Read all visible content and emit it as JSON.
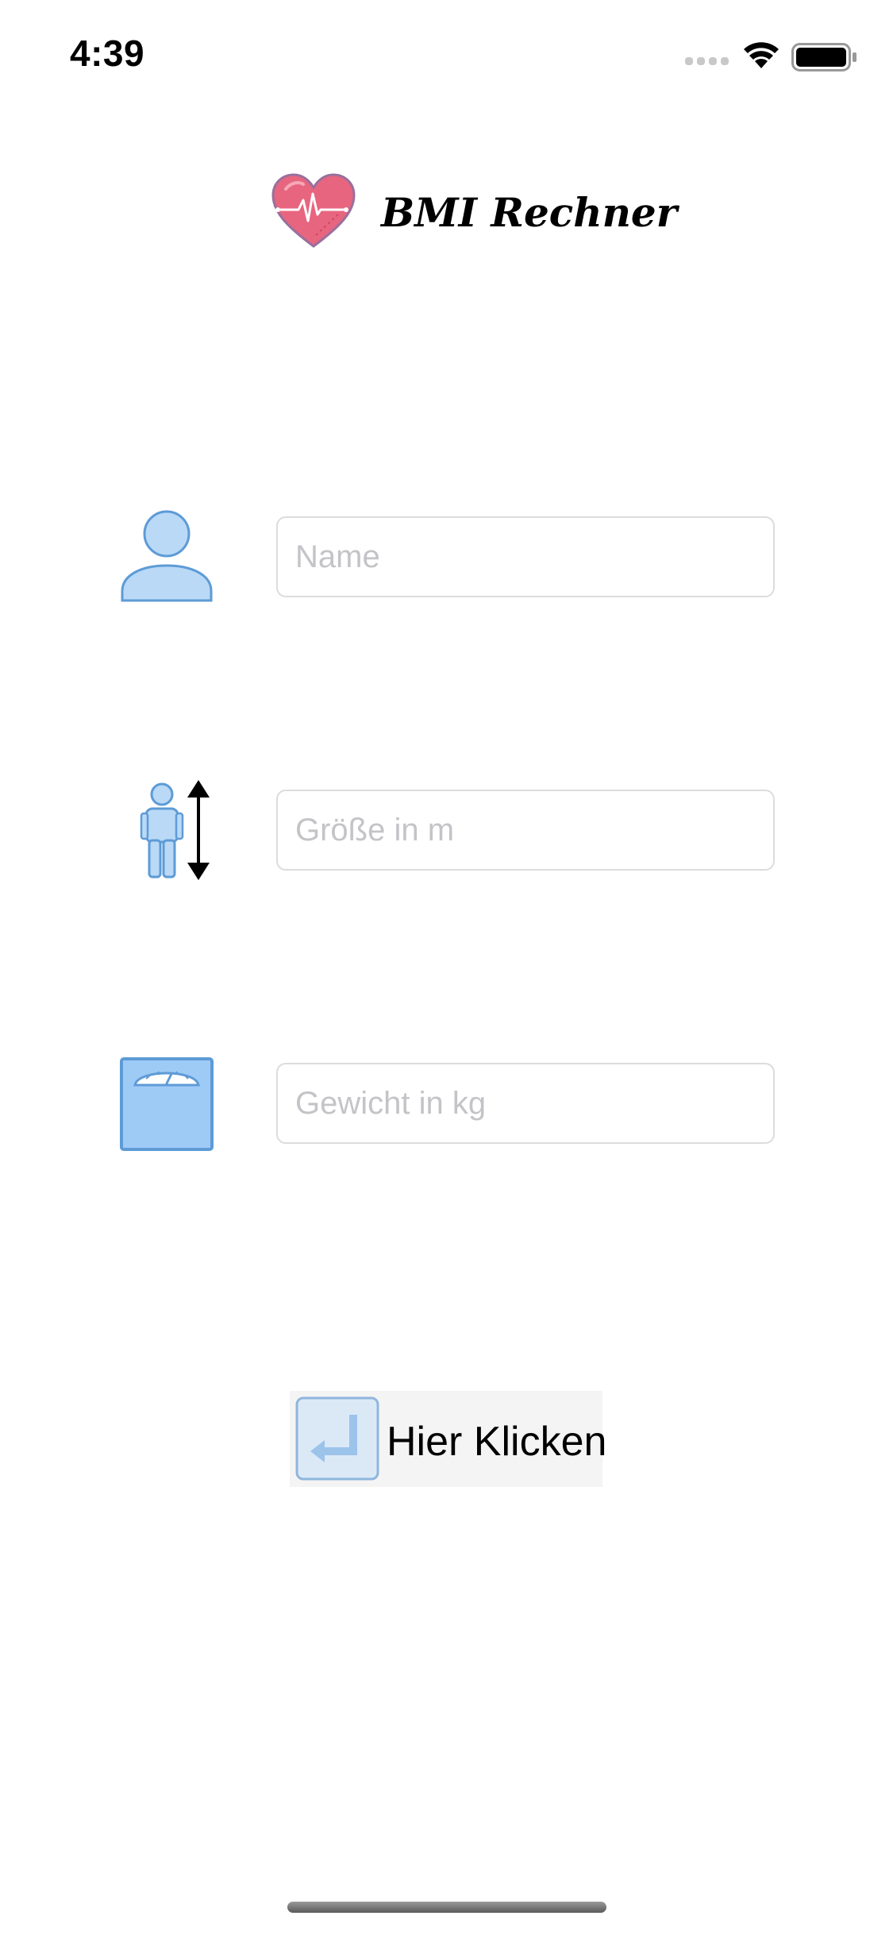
{
  "status_bar": {
    "time": "4:39",
    "icons": [
      "signal-icon",
      "wifi-icon",
      "battery-icon"
    ]
  },
  "header": {
    "logo_icon": "heart-pulse-icon",
    "title": "BMI Rechner"
  },
  "form": {
    "name": {
      "icon": "person-icon",
      "placeholder": "Name",
      "value": ""
    },
    "height": {
      "icon": "height-measure-icon",
      "placeholder": "Größe in m",
      "value": ""
    },
    "weight": {
      "icon": "weighing-scale-icon",
      "placeholder": "Gewicht in kg",
      "value": ""
    }
  },
  "submit": {
    "icon": "enter-key-icon",
    "label": "Hier Klicken"
  },
  "colors": {
    "icon_fill": "#b9d9f7",
    "icon_stroke": "#5e9bd6",
    "heart": "#e8657f",
    "button_bg": "#f4f4f4",
    "field_border": "#dcdcdc",
    "placeholder": "#c4c4c8"
  }
}
